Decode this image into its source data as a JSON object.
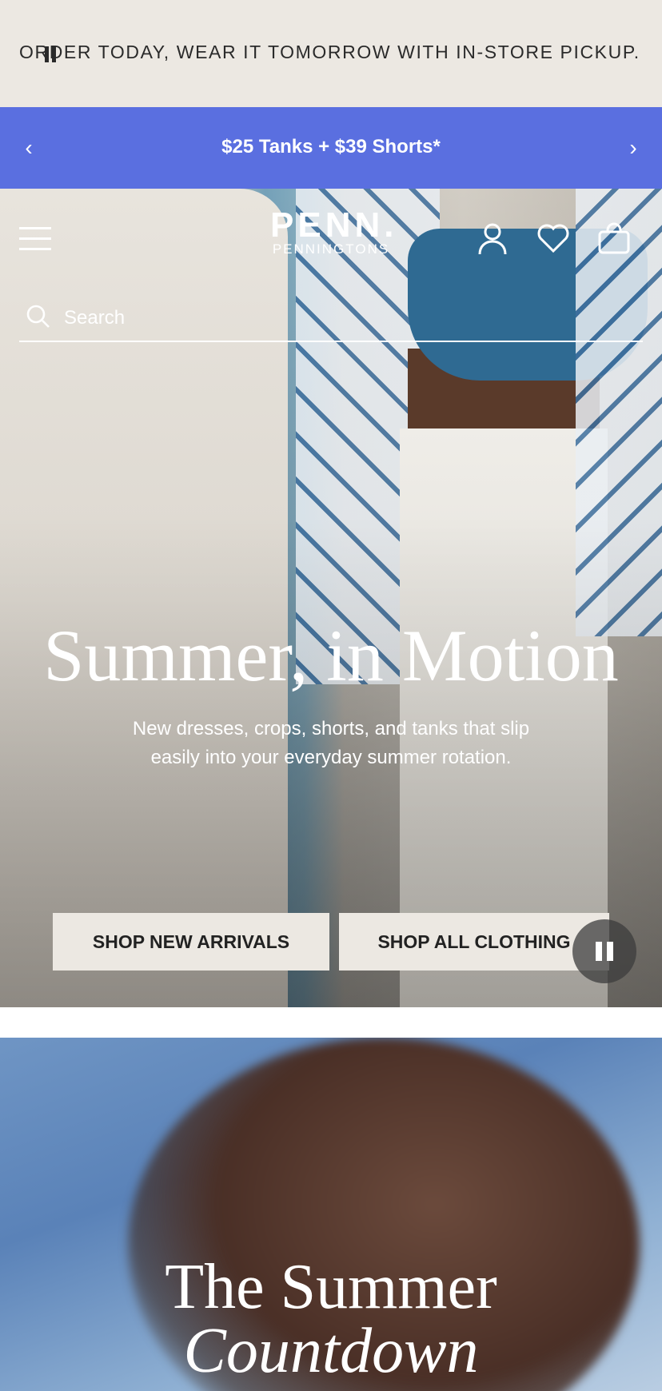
{
  "announcement": {
    "text": "ORDER TODAY, WEAR IT TOMORROW WITH IN-STORE PICKUP."
  },
  "promo": {
    "label": "$25 Tanks + $39 Shorts*",
    "prev_icon": "chevron-left-icon",
    "next_icon": "chevron-right-icon",
    "background": "#5a6fe0"
  },
  "header": {
    "logo_main": "PENN.",
    "logo_sub": "PENNINGTONS",
    "icons": [
      "menu-icon",
      "account-icon",
      "heart-icon",
      "bag-icon"
    ]
  },
  "search": {
    "placeholder": "Search",
    "icon": "search-icon"
  },
  "hero": {
    "title": "Summer, in Motion",
    "subtitle": "New dresses, crops, shorts, and tanks that slip easily into your everyday summer rotation.",
    "buttons": [
      "SHOP NEW ARRIVALS",
      "SHOP ALL CLOTHING"
    ],
    "pause_icon": "pause-icon"
  },
  "section2": {
    "title_line1": "The Summer",
    "title_line2": "Countdown"
  },
  "colors": {
    "topbar": "#ece8e2",
    "promo": "#5a6fe0",
    "button_bg": "#ece8e2"
  }
}
